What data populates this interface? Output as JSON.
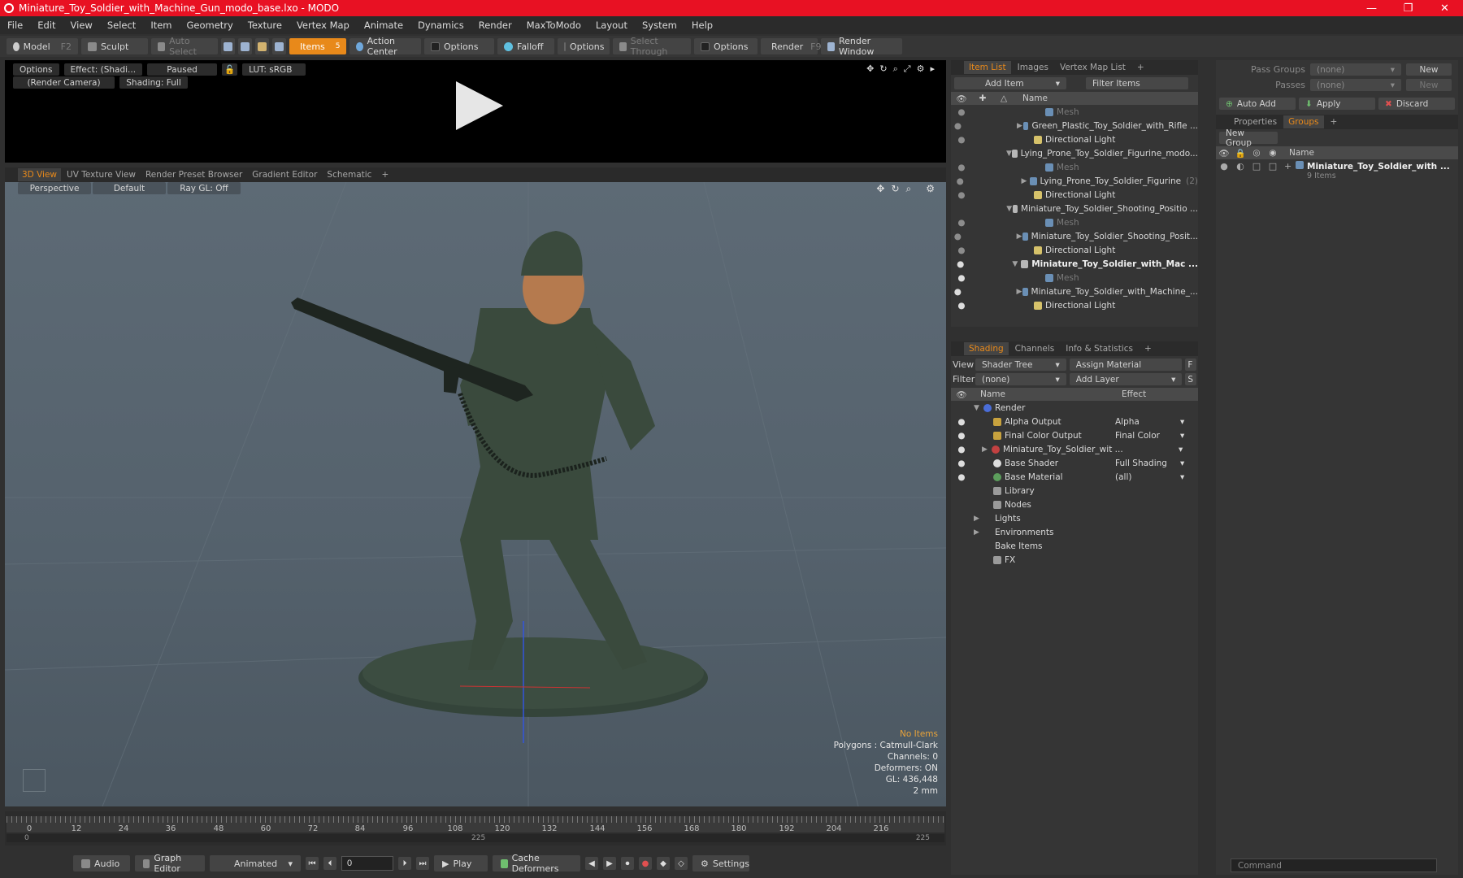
{
  "window": {
    "title": "Miniature_Toy_Soldier_with_Machine_Gun_modo_base.lxo - MODO",
    "min": "—",
    "max": "❐",
    "close": "✕"
  },
  "menu": [
    "File",
    "Edit",
    "View",
    "Select",
    "Item",
    "Geometry",
    "Texture",
    "Vertex Map",
    "Animate",
    "Dynamics",
    "Render",
    "MaxToModo",
    "Layout",
    "System",
    "Help"
  ],
  "toolbar": {
    "model": "Model",
    "model_key": "F2",
    "sculpt": "Sculpt",
    "auto_select": "Auto Select",
    "items": "Items",
    "items_key": "5",
    "action_center": "Action Center",
    "options1": "Options",
    "falloff": "Falloff",
    "options2": "Options",
    "select_through": "Select Through",
    "options3": "Options",
    "render": "Render",
    "render_key": "F9",
    "render_window": "Render Window"
  },
  "preview": {
    "options": "Options",
    "effect": "Effect: (Shadi...",
    "paused": "Paused",
    "lut": "LUT: sRGB",
    "camera": "(Render Camera)",
    "shading": "Shading: Full"
  },
  "viewport_tabs": [
    "3D View",
    "UV Texture View",
    "Render Preset Browser",
    "Gradient Editor",
    "Schematic",
    "+"
  ],
  "viewport": {
    "perspective": "Perspective",
    "default": "Default",
    "raygl": "Ray GL: Off",
    "info": {
      "no_items": "No Items",
      "polygons": "Polygons : Catmull-Clark",
      "channels": "Channels: 0",
      "deformers": "Deformers: ON",
      "gl": "GL: 436,448",
      "scale": "2 mm"
    }
  },
  "timeline": {
    "ticks": [
      "0",
      "12",
      "24",
      "36",
      "48",
      "60",
      "72",
      "84",
      "96",
      "108",
      "120",
      "132",
      "144",
      "156",
      "168",
      "180",
      "192",
      "204",
      "216"
    ],
    "range_start": "0",
    "range_mid": "225",
    "range_end": "225"
  },
  "bottombar": {
    "audio": "Audio",
    "graph_editor": "Graph Editor",
    "animated": "Animated",
    "frame": "0",
    "play": "Play",
    "cache_deformers": "Cache Deformers",
    "settings": "Settings"
  },
  "item_list": {
    "tabs": [
      "Item List",
      "Images",
      "Vertex Map List",
      "+"
    ],
    "add_item": "Add Item",
    "filter_items": "Filter Items",
    "col_name": "Name",
    "rows": [
      {
        "label": "Mesh",
        "kind": "mesh",
        "dim": true
      },
      {
        "label": "Green_Plastic_Toy_Soldier_with_Rifle ...",
        "kind": "mesh"
      },
      {
        "label": "Directional Light",
        "kind": "light"
      },
      {
        "label": "Lying_Prone_Toy_Soldier_Figurine_modo...",
        "kind": "scene"
      },
      {
        "label": "Mesh",
        "kind": "mesh",
        "dim": true
      },
      {
        "label": "Lying_Prone_Toy_Soldier_Figurine",
        "kind": "mesh",
        "suffix": "(2)"
      },
      {
        "label": "Directional Light",
        "kind": "light"
      },
      {
        "label": "Miniature_Toy_Soldier_Shooting_Positio ...",
        "kind": "scene"
      },
      {
        "label": "Mesh",
        "kind": "mesh",
        "dim": true
      },
      {
        "label": "Miniature_Toy_Soldier_Shooting_Posit...",
        "kind": "mesh"
      },
      {
        "label": "Directional Light",
        "kind": "light"
      },
      {
        "label": "Miniature_Toy_Soldier_with_Mac ...",
        "kind": "scene",
        "bold": true
      },
      {
        "label": "Mesh",
        "kind": "mesh",
        "dim": true
      },
      {
        "label": "Miniature_Toy_Soldier_with_Machine_...",
        "kind": "mesh"
      },
      {
        "label": "Directional Light",
        "kind": "light"
      }
    ]
  },
  "shading": {
    "tabs": [
      "Shading",
      "Channels",
      "Info & Statistics",
      "+"
    ],
    "view_label": "View",
    "view_value": "Shader Tree",
    "assign_material": "Assign Material",
    "f": "F",
    "filter_label": "Filter",
    "filter_value": "(none)",
    "add_layer": "Add Layer",
    "s": "S",
    "col_name": "Name",
    "col_effect": "Effect",
    "rows": [
      {
        "label": "Render",
        "effect": "",
        "kind": "render"
      },
      {
        "label": "Alpha Output",
        "effect": "Alpha",
        "kind": "out"
      },
      {
        "label": "Final Color Output",
        "effect": "Final Color",
        "kind": "out"
      },
      {
        "label": "Miniature_Toy_Soldier_wit ...",
        "effect": "",
        "kind": "mat"
      },
      {
        "label": "Base Shader",
        "effect": "Full Shading",
        "kind": "shader"
      },
      {
        "label": "Base Material",
        "effect": "(all)",
        "kind": "basemat"
      },
      {
        "label": "Library",
        "effect": "",
        "kind": "folder"
      },
      {
        "label": "Nodes",
        "effect": "",
        "kind": "folder"
      },
      {
        "label": "Lights",
        "effect": "",
        "kind": "none"
      },
      {
        "label": "Environments",
        "effect": "",
        "kind": "none"
      },
      {
        "label": "Bake Items",
        "effect": "",
        "kind": "none"
      },
      {
        "label": "FX",
        "effect": "",
        "kind": "folder"
      }
    ]
  },
  "right": {
    "pass_groups": "Pass Groups",
    "pass_value": "(none)",
    "new": "New",
    "passes": "Passes",
    "passes_value": "(none)",
    "new2": "New",
    "auto_add": "Auto Add",
    "apply": "Apply",
    "discard": "Discard",
    "tabs": [
      "Properties",
      "Groups",
      "+"
    ],
    "new_group": "New Group",
    "col_name": "Name",
    "group_name": "Miniature_Toy_Soldier_with ...",
    "group_items": "9 Items"
  },
  "command": {
    "placeholder": "Command"
  },
  "colors": {
    "accent": "#e8891a",
    "titlebar": "#e81123",
    "soldier": "#3a4a3d"
  }
}
